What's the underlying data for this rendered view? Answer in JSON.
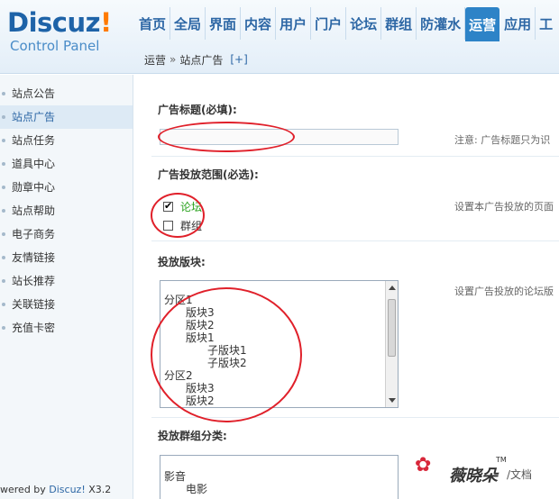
{
  "logo": {
    "brand_main": "Discuz",
    "brand_bang": "!",
    "subtitle": "Control Panel"
  },
  "nav": {
    "tabs": [
      "首页",
      "全局",
      "界面",
      "内容",
      "用户",
      "门户",
      "论坛",
      "群组",
      "防灌水",
      "运营",
      "应用",
      "工"
    ]
  },
  "breadcrumb": {
    "section": "运营",
    "separator": "»",
    "page": "站点广告",
    "add": "[+]"
  },
  "sidebar": {
    "items": [
      "站点公告",
      "站点广告",
      "站点任务",
      "道具中心",
      "勋章中心",
      "站点帮助",
      "电子商务",
      "友情链接",
      "站长推荐",
      "关联链接",
      "充值卡密"
    ],
    "active_index": 1
  },
  "footer": {
    "prefix": "wered by ",
    "brand": "Discuz!",
    "version": " X3.2"
  },
  "form": {
    "ad_title_label": "广告标题(必填):",
    "ad_title_value": "",
    "ad_title_hint": "注意: 广告标题只为识",
    "scope_label": "广告投放范围(必选):",
    "scope_hint": "设置本广告投放的页面",
    "scope_options": [
      {
        "label": "论坛",
        "checked": true
      },
      {
        "label": "群组",
        "checked": false
      }
    ],
    "forum_label": "投放版块:",
    "forum_hint": "设置广告投放的论坛版",
    "forum_options": [
      "分区1",
      "　　版块3",
      "　　版块2",
      "　　版块1",
      "　　　　子版块1",
      "　　　　子版块2",
      "分区2",
      "　　版块3",
      "　　版块2"
    ],
    "group_label": "投放群组分类:",
    "group_options": [
      "影音",
      "　　电影"
    ]
  },
  "watermark": {
    "text": "薇晓朵",
    "tm": "TM",
    "doc": "/文档"
  },
  "colors": {
    "nav_active": "#2d83c7",
    "brand": "#1e63a8",
    "bang": "#ff7a00",
    "annotation": "#e0202a",
    "checked_label": "#2aa21e"
  }
}
